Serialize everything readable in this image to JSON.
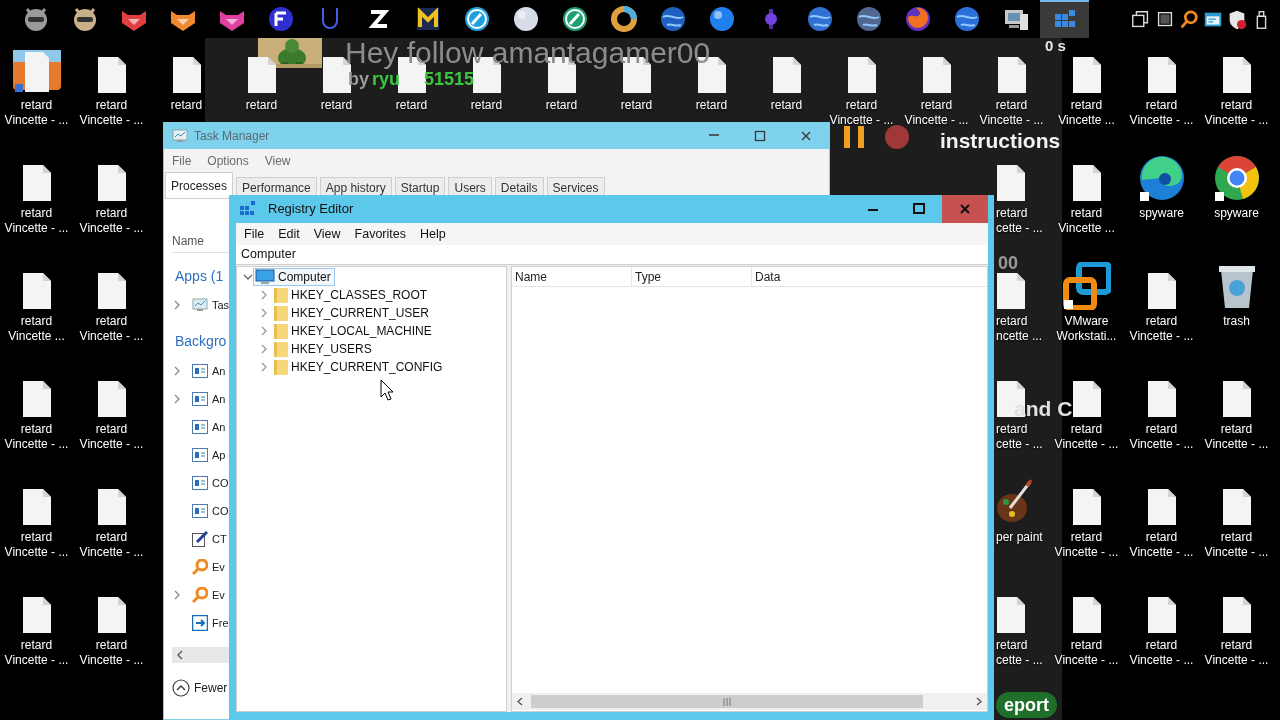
{
  "taskbar": {
    "apps": [
      {
        "selected": false
      },
      {
        "selected": false
      },
      {
        "selected": false
      },
      {
        "selected": false
      },
      {
        "selected": false
      },
      {
        "selected": false
      },
      {
        "selected": false
      },
      {
        "selected": false
      },
      {
        "selected": false
      },
      {
        "selected": false
      },
      {
        "selected": false
      },
      {
        "selected": false
      },
      {
        "selected": false
      },
      {
        "selected": false
      },
      {
        "selected": false
      },
      {
        "selected": false
      },
      {
        "selected": false
      },
      {
        "selected": false
      },
      {
        "selected": false
      },
      {
        "selected": false
      },
      {
        "selected": false
      },
      {
        "selected": true
      }
    ]
  },
  "stream_overlay": [
    {
      "kind": "text",
      "text": "Hey follow amantagamer00",
      "color": "#8c8c8c"
    },
    {
      "kind": "text",
      "text": "by",
      "color": "#9a9a9a"
    },
    {
      "kind": "text",
      "text": "ryu",
      "color": "#3cc43f"
    },
    {
      "kind": "text",
      "text": "51515",
      "color": "#3cc43f"
    },
    {
      "kind": "text",
      "text": "0 s",
      "color": "#e8e8e8"
    },
    {
      "kind": "text",
      "text": "instructions",
      "color": "#f2f2f2"
    },
    {
      "kind": "text",
      "text": "00",
      "color": "#9a9a9a"
    },
    {
      "kind": "text",
      "text": "and C",
      "color": "#e0e0e0"
    },
    {
      "kind": "pill",
      "text": "eport",
      "color": "#1f6e2a"
    }
  ],
  "desktop": {
    "top_row": [
      {
        "lines": [
          "retard",
          "Vincette - ..."
        ]
      },
      {
        "kind": "file",
        "lines": [
          "retard",
          "Vincette - ..."
        ]
      },
      {
        "kind": "file",
        "lines": [
          "retard"
        ]
      },
      {
        "kind": "file",
        "lines": [
          "retard"
        ]
      },
      {
        "kind": "file",
        "lines": [
          "retard"
        ]
      },
      {
        "kind": "file",
        "lines": [
          "retard"
        ]
      },
      {
        "kind": "file",
        "lines": [
          "retard"
        ]
      },
      {
        "kind": "file",
        "lines": [
          "retard"
        ]
      },
      {
        "kind": "file",
        "lines": [
          "retard"
        ]
      },
      {
        "kind": "file",
        "lines": [
          "retard"
        ]
      },
      {
        "kind": "file",
        "lines": [
          "retard"
        ]
      },
      {
        "kind": "file",
        "lines": [
          "retard",
          "Vincette - ..."
        ]
      },
      {
        "kind": "file",
        "lines": [
          "retard",
          "Vincette - ..."
        ]
      },
      {
        "kind": "file",
        "lines": [
          "retard",
          "Vincette - ..."
        ]
      },
      {
        "kind": "file",
        "lines": [
          "retard",
          "Vincette ..."
        ]
      },
      {
        "kind": "file",
        "lines": [
          "retard",
          "Vincette - ..."
        ]
      },
      {
        "kind": "file",
        "lines": [
          "retard",
          "Vincette - ..."
        ]
      }
    ],
    "left_columns": [
      {
        "kind": "file",
        "lines": [
          "retard",
          "Vincette - ..."
        ]
      },
      {
        "kind": "file",
        "lines": [
          "retard",
          "Vincette - ..."
        ]
      },
      {
        "kind": "file",
        "lines": [
          "retard",
          "Vincette ..."
        ]
      },
      {
        "kind": "file",
        "lines": [
          "retard",
          "Vincette - ..."
        ]
      },
      {
        "kind": "file",
        "lines": [
          "retard",
          "Vincette - ..."
        ]
      },
      {
        "kind": "file",
        "lines": [
          "retard",
          "Vincette - ..."
        ]
      },
      {
        "kind": "file",
        "lines": [
          "retard",
          "Vincette - ..."
        ]
      },
      {
        "kind": "file",
        "lines": [
          "retard",
          "Vincette - ..."
        ]
      },
      {
        "kind": "file",
        "lines": [
          "retard",
          "Vincette - ..."
        ]
      },
      {
        "kind": "file",
        "lines": [
          "retard",
          "Vincette - ..."
        ]
      }
    ],
    "right_columns": [
      {
        "kind": "file",
        "lines": [
          "retard",
          "cette - ..."
        ]
      },
      {
        "kind": "file",
        "lines": [
          "retard",
          "Vincette ..."
        ]
      },
      {
        "kind": "edge",
        "lines": [
          "spyware"
        ]
      },
      {
        "kind": "chrome",
        "lines": [
          "spyware"
        ]
      },
      {
        "kind": "file",
        "lines": [
          "retard",
          "ncette ..."
        ]
      },
      {
        "kind": "vmware",
        "lines": [
          "VMware",
          "Workstati..."
        ]
      },
      {
        "kind": "file",
        "lines": [
          "retard",
          "Vincette - ..."
        ]
      },
      {
        "kind": "trash",
        "lines": [
          "trash"
        ]
      },
      {
        "kind": "file",
        "lines": [
          "retard",
          "cette - ..."
        ]
      },
      {
        "kind": "file",
        "lines": [
          "retard",
          "Vincette - ..."
        ]
      },
      {
        "kind": "file",
        "lines": [
          "retard",
          "Vincette - ..."
        ]
      },
      {
        "kind": "file",
        "lines": [
          "retard",
          "Vincette - ..."
        ]
      },
      {
        "kind": "paint",
        "lines": [
          "per paint"
        ]
      },
      {
        "kind": "file",
        "lines": [
          "retard",
          "Vincette - ..."
        ]
      },
      {
        "kind": "file",
        "lines": [
          "retard",
          "Vincette - ..."
        ]
      },
      {
        "kind": "file",
        "lines": [
          "retard",
          "Vincette - ..."
        ]
      },
      {
        "kind": "file",
        "lines": [
          "retard",
          "cette - ..."
        ]
      },
      {
        "kind": "file",
        "lines": [
          "retard",
          "Vincette - ..."
        ]
      },
      {
        "kind": "file",
        "lines": [
          "retard",
          "Vincette - ..."
        ]
      },
      {
        "kind": "file",
        "lines": [
          "retard",
          "Vincette - ..."
        ]
      }
    ]
  },
  "task_manager": {
    "title": "Task Manager",
    "menu": [
      "File",
      "Options",
      "View"
    ],
    "tabs": [
      {
        "label": "Processes",
        "selected": true
      },
      {
        "label": "Performance",
        "selected": false
      },
      {
        "label": "App history",
        "selected": false
      },
      {
        "label": "Startup",
        "selected": false
      },
      {
        "label": "Users",
        "selected": false
      },
      {
        "label": "Details",
        "selected": false
      },
      {
        "label": "Services",
        "selected": false
      }
    ],
    "column_header": "Name",
    "groups": [
      {
        "title": "Apps (1",
        "rows": [
          {
            "name": "Tas",
            "kind": "monitor",
            "expandable": true
          }
        ]
      },
      {
        "title": "Backgro",
        "rows": [
          {
            "name": "An",
            "kind": "window",
            "expandable": true
          },
          {
            "name": "An",
            "kind": "window",
            "expandable": true
          },
          {
            "name": "An",
            "kind": "window",
            "expandable": false
          },
          {
            "name": "Ap",
            "kind": "window",
            "expandable": false
          },
          {
            "name": "CO",
            "kind": "window",
            "expandable": false
          },
          {
            "name": "CO",
            "kind": "window",
            "expandable": false
          },
          {
            "name": "CT",
            "kind": "pen",
            "expandable": false
          },
          {
            "name": "Ev",
            "kind": "key",
            "expandable": false
          },
          {
            "name": "Ev",
            "kind": "key",
            "expandable": true
          },
          {
            "name": "Fre",
            "kind": "app",
            "expandable": false
          }
        ]
      }
    ],
    "footer": "Fewer"
  },
  "registry_editor": {
    "title": "Registry Editor",
    "menu": [
      "File",
      "Edit",
      "View",
      "Favorites",
      "Help"
    ],
    "address": "Computer",
    "tree": [
      {
        "label": "Computer",
        "expanded": true,
        "selected": true,
        "children": [
          {
            "label": "HKEY_CLASSES_ROOT",
            "expanded": false,
            "selected": false
          },
          {
            "label": "HKEY_CURRENT_USER",
            "expanded": false,
            "selected": false
          },
          {
            "label": "HKEY_LOCAL_MACHINE",
            "expanded": false,
            "selected": false
          },
          {
            "label": "HKEY_USERS",
            "expanded": false,
            "selected": false
          },
          {
            "label": "HKEY_CURRENT_CONFIG",
            "expanded": false,
            "selected": false
          }
        ]
      }
    ],
    "columns": [
      "Name",
      "Type",
      "Data"
    ]
  }
}
